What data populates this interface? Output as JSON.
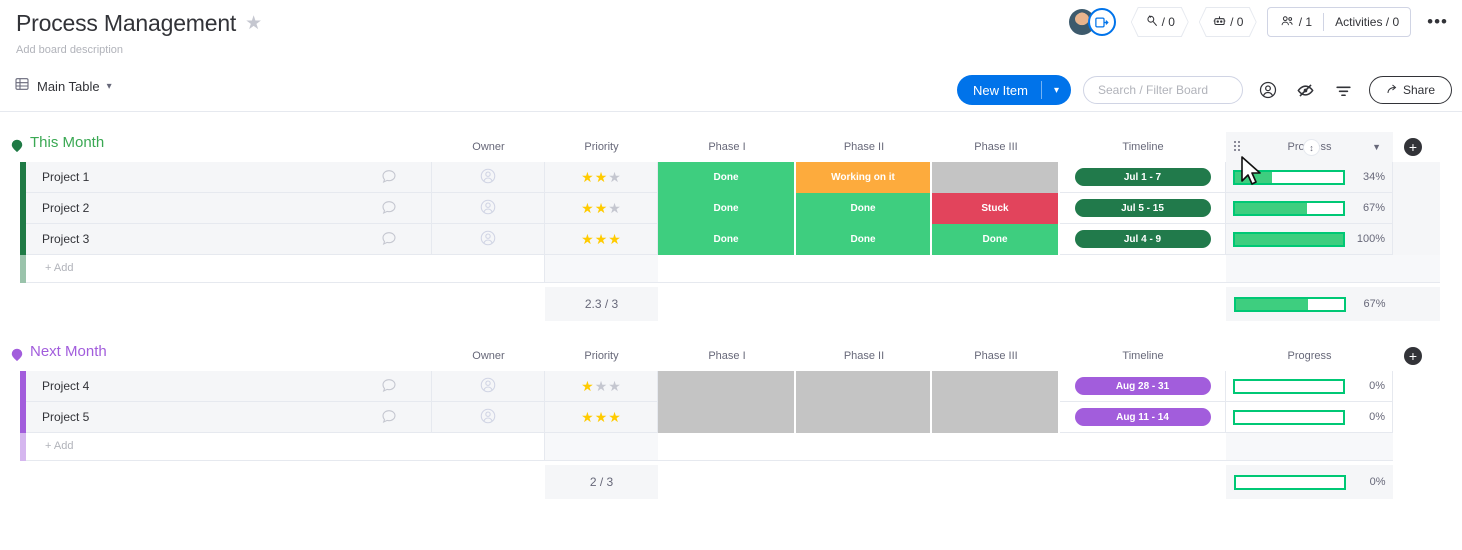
{
  "header": {
    "board_title": "Process Management",
    "star_icon": "star-icon",
    "board_description": "Add board description",
    "integrations": {
      "icon": "integration-icon",
      "label": "/ 0"
    },
    "automations": {
      "icon": "robot-icon",
      "label": "/ 0"
    },
    "members": {
      "icon": "people-icon",
      "label": "/ 1"
    },
    "activities_label": "Activities / 0",
    "more_label": "•••",
    "avatar_name": "avatar",
    "avatar_badge_icon": "invite-icon"
  },
  "toolbar": {
    "table_icon": "table-icon",
    "tab_label": "Main Table",
    "caret_icon": "chevron-down-icon",
    "new_item_label": "New Item",
    "new_item_caret": "chevron-down-icon",
    "search_placeholder": "Search / Filter Board",
    "person_icon": "person-filter-icon",
    "hide_icon": "eye-hidden-icon",
    "filter_icon": "sort-filter-icon",
    "share_icon": "share-icon",
    "share_label": "Share"
  },
  "columns": [
    "Owner",
    "Priority",
    "Phase I",
    "Phase II",
    "Phase III",
    "Timeline",
    "Progress"
  ],
  "add_row_label": "+ Add",
  "add_column_icon": "plus-circle-icon",
  "colors": {
    "green": "#3ece7f",
    "orange": "#fdab3d",
    "red": "#e2445c",
    "gray": "#c4c4c4",
    "timeline_green": "#217a4b",
    "timeline_purple": "#a25ddc",
    "group_green": "#3aa853",
    "group_purple": "#a25ddc",
    "accent_blue": "#0073ea",
    "star_on": "#ffcb00",
    "star_off": "#c5c7d0"
  },
  "groups": [
    {
      "name": "This Month",
      "color": "#1f7a45",
      "title_color": "#3aa853",
      "arrow_icon": "collapse-arrow-icon",
      "rows": [
        {
          "name": "Project 1",
          "conversation_icon": "comment-icon",
          "owner_icon": "person-placeholder-icon",
          "priority": 2,
          "priority_max": 3,
          "phase1": {
            "label": "Done",
            "color": "#3ece7f"
          },
          "phase2": {
            "label": "Working on it",
            "color": "#fdab3d"
          },
          "phase3": {
            "label": "",
            "color": "#c4c4c4"
          },
          "timeline": {
            "label": "Jul 1 - 7",
            "color": "#217a4b"
          },
          "progress": 34,
          "progress_label": "34%"
        },
        {
          "name": "Project 2",
          "conversation_icon": "comment-icon",
          "owner_icon": "person-placeholder-icon",
          "priority": 2,
          "priority_max": 3,
          "phase1": {
            "label": "Done",
            "color": "#3ece7f"
          },
          "phase2": {
            "label": "Done",
            "color": "#3ece7f"
          },
          "phase3": {
            "label": "Stuck",
            "color": "#e2445c"
          },
          "timeline": {
            "label": "Jul 5 - 15",
            "color": "#217a4b"
          },
          "progress": 67,
          "progress_label": "67%"
        },
        {
          "name": "Project 3",
          "conversation_icon": "comment-icon",
          "owner_icon": "person-placeholder-icon",
          "priority": 3,
          "priority_max": 3,
          "phase1": {
            "label": "Done",
            "color": "#3ece7f"
          },
          "phase2": {
            "label": "Done",
            "color": "#3ece7f"
          },
          "phase3": {
            "label": "Done",
            "color": "#3ece7f"
          },
          "timeline": {
            "label": "Jul 4 - 9",
            "color": "#217a4b"
          },
          "progress": 100,
          "progress_label": "100%"
        }
      ],
      "summary": {
        "priority": "2.3 / 3",
        "progress": 67,
        "progress_label": "67%"
      }
    },
    {
      "name": "Next Month",
      "color": "#a25ddc",
      "title_color": "#a25ddc",
      "arrow_icon": "collapse-arrow-icon",
      "rows": [
        {
          "name": "Project 4",
          "conversation_icon": "comment-icon",
          "owner_icon": "person-placeholder-icon",
          "priority": 1,
          "priority_max": 3,
          "phase1": {
            "label": "",
            "color": "#c4c4c4"
          },
          "phase2": {
            "label": "",
            "color": "#c4c4c4"
          },
          "phase3": {
            "label": "",
            "color": "#c4c4c4"
          },
          "timeline": {
            "label": "Aug 28 - 31",
            "color": "#a25ddc"
          },
          "progress": 0,
          "progress_label": "0%"
        },
        {
          "name": "Project 5",
          "conversation_icon": "comment-icon",
          "owner_icon": "person-placeholder-icon",
          "priority": 3,
          "priority_max": 3,
          "phase1": {
            "label": "",
            "color": "#c4c4c4"
          },
          "phase2": {
            "label": "",
            "color": "#c4c4c4"
          },
          "phase3": {
            "label": "",
            "color": "#c4c4c4"
          },
          "timeline": {
            "label": "Aug 11 - 14",
            "color": "#a25ddc"
          },
          "progress": 0,
          "progress_label": "0%"
        }
      ],
      "summary": {
        "priority": "2 / 3",
        "progress": 0,
        "progress_label": "0%"
      }
    }
  ],
  "progress_column_header": {
    "label": "Progress",
    "drag_handle_icon": "drag-handle-icon",
    "menu_icon": "chevron-down-icon",
    "sort_badge_icon": "sort-updown-icon",
    "cursor_icon": "mouse-cursor-icon"
  }
}
